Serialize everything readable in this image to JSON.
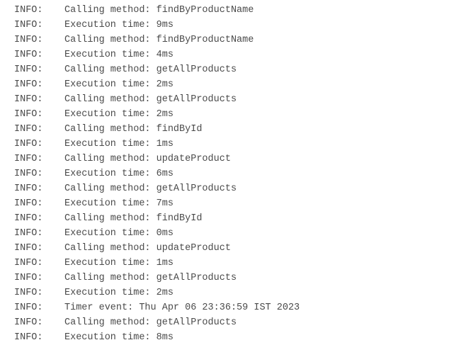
{
  "log": {
    "lines": [
      {
        "level": "INFO:",
        "message": "Calling method: findByProductName"
      },
      {
        "level": "INFO:",
        "message": "Execution time: 9ms"
      },
      {
        "level": "INFO:",
        "message": "Calling method: findByProductName"
      },
      {
        "level": "INFO:",
        "message": "Execution time: 4ms"
      },
      {
        "level": "INFO:",
        "message": "Calling method: getAllProducts"
      },
      {
        "level": "INFO:",
        "message": "Execution time: 2ms"
      },
      {
        "level": "INFO:",
        "message": "Calling method: getAllProducts"
      },
      {
        "level": "INFO:",
        "message": "Execution time: 2ms"
      },
      {
        "level": "INFO:",
        "message": "Calling method: findById"
      },
      {
        "level": "INFO:",
        "message": "Execution time: 1ms"
      },
      {
        "level": "INFO:",
        "message": "Calling method: updateProduct"
      },
      {
        "level": "INFO:",
        "message": "Execution time: 6ms"
      },
      {
        "level": "INFO:",
        "message": "Calling method: getAllProducts"
      },
      {
        "level": "INFO:",
        "message": "Execution time: 7ms"
      },
      {
        "level": "INFO:",
        "message": "Calling method: findById"
      },
      {
        "level": "INFO:",
        "message": "Execution time: 0ms"
      },
      {
        "level": "INFO:",
        "message": "Calling method: updateProduct"
      },
      {
        "level": "INFO:",
        "message": "Execution time: 1ms"
      },
      {
        "level": "INFO:",
        "message": "Calling method: getAllProducts"
      },
      {
        "level": "INFO:",
        "message": "Execution time: 2ms"
      },
      {
        "level": "INFO:",
        "message": "Timer event: Thu Apr 06 23:36:59 IST 2023"
      },
      {
        "level": "INFO:",
        "message": "Calling method: getAllProducts"
      },
      {
        "level": "INFO:",
        "message": "Execution time: 8ms"
      }
    ]
  }
}
